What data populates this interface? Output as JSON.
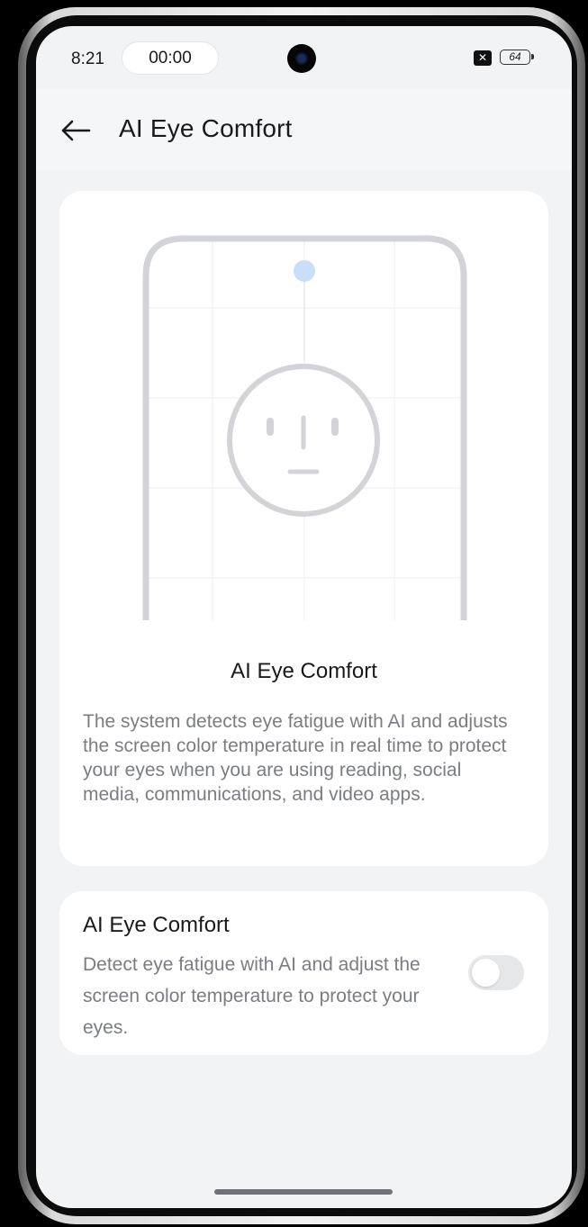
{
  "status_bar": {
    "time": "8:21",
    "timer": "00:00",
    "sim_glyph": "✕",
    "battery": "64"
  },
  "header": {
    "title": "AI Eye Comfort"
  },
  "info_card": {
    "title": "AI Eye Comfort",
    "description": "The system detects eye fatigue with AI and adjusts the screen color temperature in real time to protect your eyes when you are using reading, social media, communications, and video apps."
  },
  "toggle_card": {
    "title": "AI Eye Comfort",
    "description": "Detect eye fatigue with AI and adjust the screen color temperature to protect your eyes.",
    "enabled": false
  },
  "icons": {
    "back": "back-arrow-icon",
    "camera": "front-camera-icon",
    "sim": "sim-status-icon",
    "battery": "battery-icon",
    "illustration": "face-detection-illustration"
  },
  "colors": {
    "background": "#f1f3f5",
    "card": "#ffffff",
    "sensor_dot": "#c9def8",
    "illustration_stroke": "#d3d4d7"
  }
}
